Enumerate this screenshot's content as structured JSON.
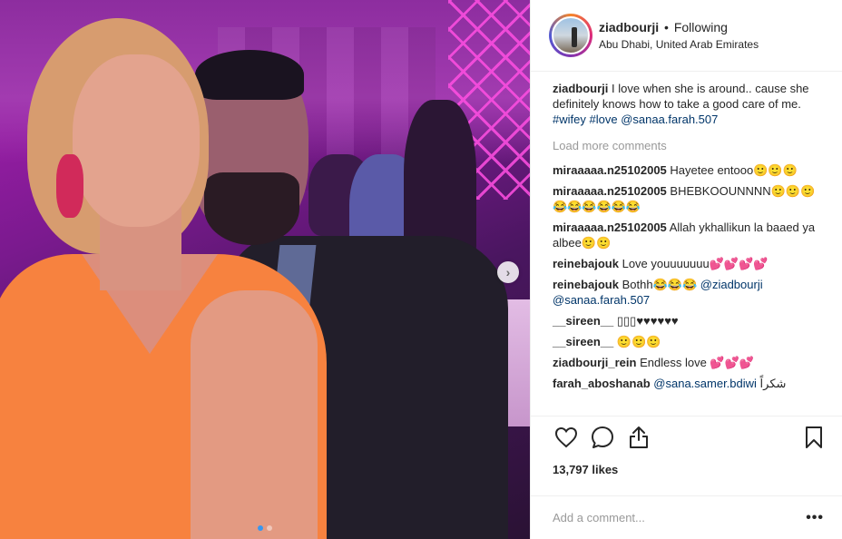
{
  "header": {
    "username": "ziadbourji",
    "separator": "•",
    "follow_status": "Following",
    "location": "Abu Dhabi, United Arab Emirates"
  },
  "caption": {
    "username": "ziadbourji",
    "text": "I love when she is around.. cause she definitely knows how to take a good care of me.",
    "tag1": "#wifey",
    "tag2": "#love",
    "tag3": "@sanaa.farah.507"
  },
  "load_more": "Load more comments",
  "comments": [
    {
      "user": "miraaaaa.n25102005",
      "text": "Hayetee entooo🙂🙂🙂"
    },
    {
      "user": "miraaaaa.n25102005",
      "text": "BHEBKOOUNNNN🙂🙂🙂😂😂😂😂😂😂"
    },
    {
      "user": "miraaaaa.n25102005",
      "text": "Allah ykhallikun la baaed ya albee🙂🙂"
    },
    {
      "user": "reinebajouk",
      "text": "Love youuuuuuu💕💕💕💕"
    },
    {
      "user": "reinebajouk",
      "text": "Bothh😂😂😂",
      "tag1": "@ziadbourji",
      "tag2": "@sanaa.farah.507"
    },
    {
      "user": "__sireen__",
      "text": "▯▯▯♥♥♥♥♥♥"
    },
    {
      "user": "__sireen__",
      "text": "🙂🙂🙂"
    },
    {
      "user": "ziadbourji_rein",
      "text": "Endless love 💕💕💕"
    },
    {
      "user": "farah_aboshanab",
      "tag1": "@sana.samer.bdiwi",
      "text": "شكراً"
    }
  ],
  "actions": {
    "like_icon": "heart-icon",
    "comment_icon": "comment-icon",
    "share_icon": "share-icon",
    "save_icon": "bookmark-icon",
    "likes": "13,797 likes"
  },
  "add_comment": {
    "placeholder": "Add a comment...",
    "more_label": "•••"
  },
  "carousel": {
    "next_label": "›",
    "slide_count": 2,
    "active_slide": 1
  },
  "colors": {
    "link": "#003569",
    "muted": "#999999",
    "border": "#efefef",
    "active_dot": "#3897f0"
  }
}
